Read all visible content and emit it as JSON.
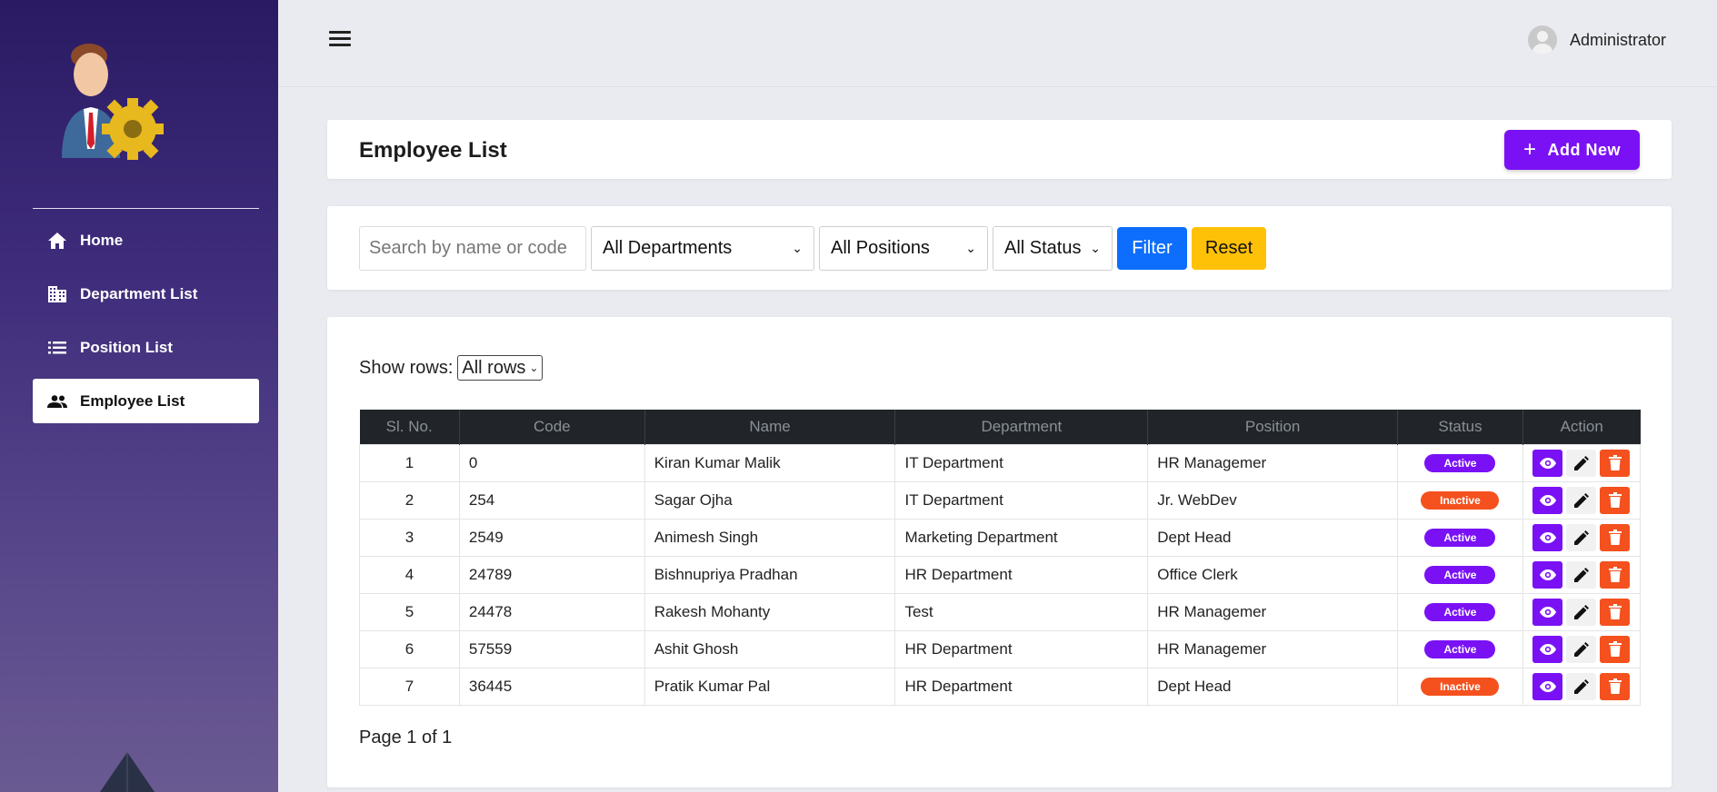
{
  "sidebar": {
    "items": [
      {
        "label": "Home",
        "icon": "home-icon"
      },
      {
        "label": "Department List",
        "icon": "building-icon"
      },
      {
        "label": "Position List",
        "icon": "list-icon"
      },
      {
        "label": "Employee List",
        "icon": "people-icon",
        "active": true
      }
    ]
  },
  "header": {
    "user_name": "Administrator"
  },
  "page": {
    "title": "Employee List",
    "add_button_label": "Add New"
  },
  "filters": {
    "search_placeholder": "Search by name or code",
    "department": "All Departments",
    "position": "All Positions",
    "status": "All Status",
    "filter_label": "Filter",
    "reset_label": "Reset"
  },
  "table": {
    "show_rows_label": "Show rows:",
    "rows_value": "All rows",
    "columns": [
      "Sl. No.",
      "Code",
      "Name",
      "Department",
      "Position",
      "Status",
      "Action"
    ],
    "rows": [
      {
        "sl": "1",
        "code": "0",
        "name": "Kiran Kumar Malik",
        "department": "IT Department",
        "position": "HR Managemer",
        "status": "Active"
      },
      {
        "sl": "2",
        "code": "254",
        "name": "Sagar Ojha",
        "department": "IT Department",
        "position": "Jr. WebDev",
        "status": "Inactive"
      },
      {
        "sl": "3",
        "code": "2549",
        "name": "Animesh Singh",
        "department": "Marketing Department",
        "position": "Dept Head",
        "status": "Active"
      },
      {
        "sl": "4",
        "code": "24789",
        "name": "Bishnupriya Pradhan",
        "department": "HR Department",
        "position": "Office Clerk",
        "status": "Active"
      },
      {
        "sl": "5",
        "code": "24478",
        "name": "Rakesh Mohanty",
        "department": "Test",
        "position": "HR Managemer",
        "status": "Active"
      },
      {
        "sl": "6",
        "code": "57559",
        "name": "Ashit Ghosh",
        "department": "HR Department",
        "position": "HR Managemer",
        "status": "Active"
      },
      {
        "sl": "7",
        "code": "36445",
        "name": "Pratik Kumar Pal",
        "department": "HR Department",
        "position": "Dept Head",
        "status": "Inactive"
      }
    ],
    "pagination": "Page 1 of 1"
  },
  "colors": {
    "primary": "#7a11f5",
    "danger": "#f4511e",
    "filter": "#0d6efd",
    "reset": "#ffc107",
    "sidebar_top": "#2a1a63"
  }
}
